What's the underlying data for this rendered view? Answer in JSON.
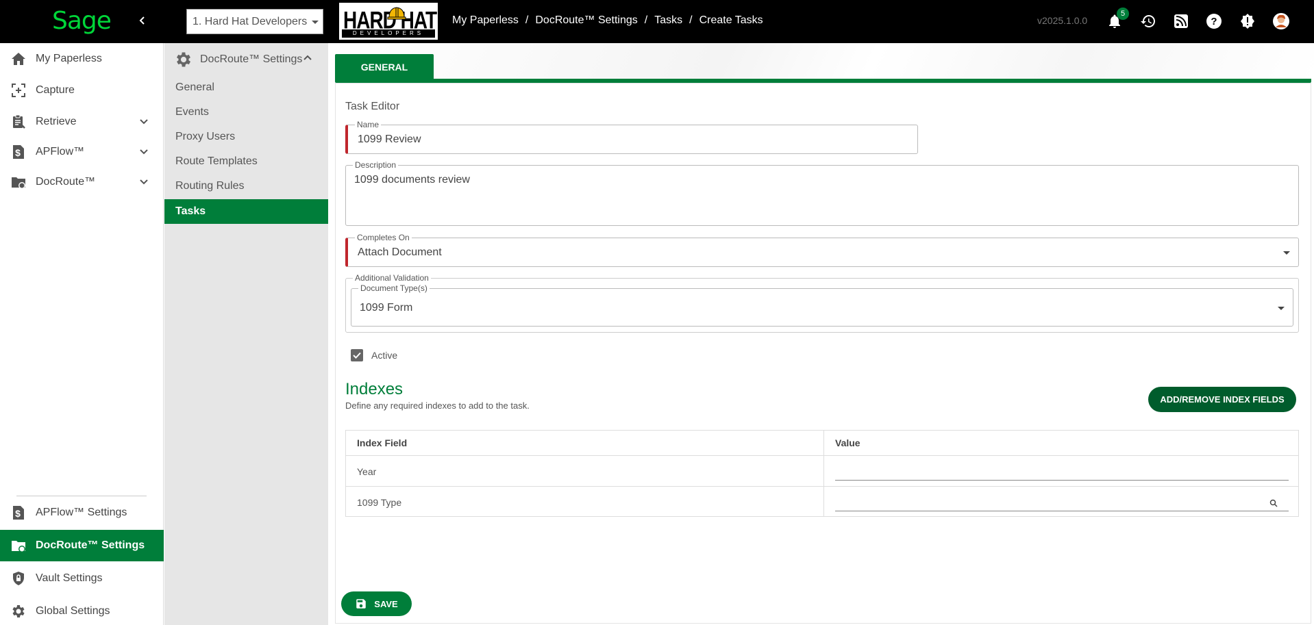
{
  "header": {
    "logo_text": "Sage",
    "company_selector": "1. Hard Hat Developers",
    "company_logo": {
      "main": "HARD HAT",
      "sub": "DEVELOPERS"
    },
    "breadcrumb": [
      "My Paperless",
      "DocRoute™ Settings",
      "Tasks",
      "Create Tasks"
    ],
    "version": "v2025.1.0.0",
    "notification_count": "5",
    "icons": [
      "bell-icon",
      "history-icon",
      "rss-icon",
      "help-icon",
      "alert-icon",
      "user-avatar"
    ]
  },
  "sidebar": {
    "items": [
      {
        "label": "My Paperless",
        "icon": "home-icon"
      },
      {
        "label": "Capture",
        "icon": "capture-icon"
      },
      {
        "label": "Retrieve",
        "icon": "clipboard-icon"
      },
      {
        "label": "APFlow™",
        "icon": "dollar-doc-icon"
      },
      {
        "label": "DocRoute™",
        "icon": "folder-route-icon"
      }
    ],
    "bottom_items": [
      {
        "label": "APFlow™ Settings",
        "icon": "dollar-doc-icon"
      },
      {
        "label": "DocRoute™ Settings",
        "icon": "folder-route-icon"
      },
      {
        "label": "Vault Settings",
        "icon": "shield-lock-icon"
      },
      {
        "label": "Global Settings",
        "icon": "gear-icon"
      }
    ]
  },
  "subnav": {
    "title": "DocRoute™ Settings",
    "items": [
      "General",
      "Events",
      "Proxy Users",
      "Route Templates",
      "Routing Rules",
      "Tasks"
    ]
  },
  "main": {
    "tab": "GENERAL",
    "section_title": "Task Editor",
    "name": {
      "label": "Name",
      "value": "1099 Review"
    },
    "description": {
      "label": "Description",
      "value": "1099 documents review"
    },
    "completes_on": {
      "label": "Completes On",
      "value": "Attach Document"
    },
    "additional_validation": {
      "label": "Additional Validation",
      "document_types": {
        "label": "Document Type(s)",
        "value": "1099 Form"
      }
    },
    "active_label": "Active",
    "indexes": {
      "title": "Indexes",
      "subtitle": "Define any required indexes to add to the task.",
      "button": "ADD/REMOVE INDEX FIELDS",
      "columns": [
        "Index Field",
        "Value"
      ],
      "rows": [
        {
          "field": "Year",
          "value": ""
        },
        {
          "field": "1099 Type",
          "value": ""
        }
      ]
    },
    "save_label": "SAVE"
  },
  "colors": {
    "brand_green": "#007e3a",
    "required": "#c0262d",
    "sage_green": "#00d639"
  }
}
